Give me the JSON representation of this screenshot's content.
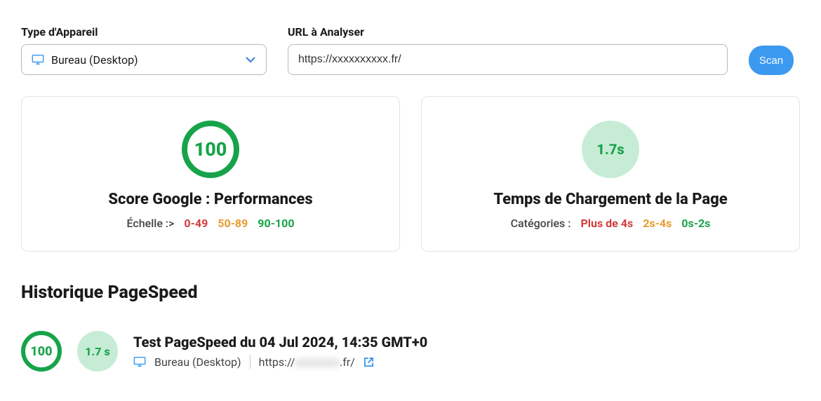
{
  "form": {
    "device_label": "Type d'Appareil",
    "device_value": "Bureau (Desktop)",
    "url_label": "URL à Analyser",
    "url_value": "https://xxxxxxxxxx.fr/",
    "scan_button": "Scan"
  },
  "cards": {
    "score": {
      "value": "100",
      "title": "Score Google : Performances",
      "scale_label": "Échelle :>",
      "range_low": "0-49",
      "range_mid": "50-89",
      "range_high": "90-100"
    },
    "load": {
      "value": "1.7s",
      "title": "Temps de Chargement de la Page",
      "cat_label": "Catégories :",
      "cat_slow": "Plus de 4s",
      "cat_mid": "2s-4s",
      "cat_fast": "0s-2s"
    }
  },
  "history": {
    "title": "Historique PageSpeed",
    "item": {
      "score": "100",
      "time": "1.7 s",
      "heading": "Test PageSpeed du 04 Jul 2024, 14:35 GMT+0",
      "device": "Bureau (Desktop)",
      "url_prefix": "https://",
      "url_hidden": "xxxxxxxx",
      "url_suffix": ".fr/"
    }
  }
}
